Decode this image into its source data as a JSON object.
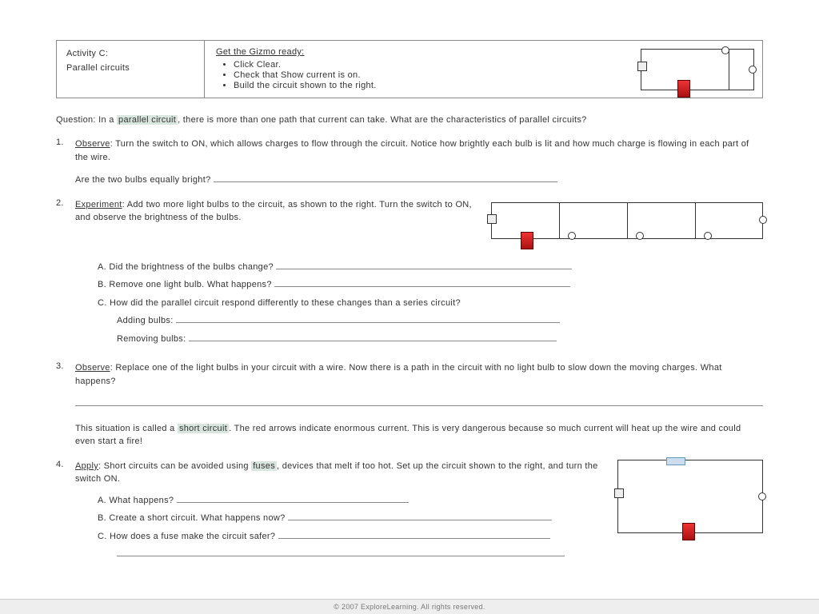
{
  "header": {
    "activity_label": "Activity C:",
    "activity_name": "Parallel circuits",
    "ready_title": "Get the Gizmo ready:",
    "ready_items": [
      "Click Clear.",
      "Check that Show current is on.",
      "Build the circuit shown to the right."
    ]
  },
  "question": {
    "lead": "Question: In a ",
    "hl": "parallel circuit",
    "rest": ", there is more than one path that current can take. What are the characteristics of parallel circuits?"
  },
  "q1": {
    "num": "1.",
    "label": "Observe",
    "text": ": Turn the switch to ON, which allows charges to flow through the circuit. Notice how brightly each bulb is lit and how much charge is flowing in each part of the wire.",
    "prompt": "Are the two bulbs equally bright? "
  },
  "q2": {
    "num": "2.",
    "label": "Experiment",
    "text": ": Add two more light bulbs to the circuit, as shown to the right. Turn the switch to ON, and observe the brightness of the bulbs.",
    "a": "A.   Did the brightness of the bulbs change? ",
    "b": "B.   Remove one light bulb. What happens? ",
    "c": "C.   How did the parallel circuit respond differently to these changes than a series circuit?",
    "c_add": "Adding bulbs: ",
    "c_rem": "Removing bulbs: "
  },
  "q3": {
    "num": "3.",
    "label": "Observe",
    "text": ": Replace one of the light bulbs in your circuit with a wire. Now there is a path in the circuit with no light bulb to slow down the moving charges. What happens?",
    "p2a": "This situation is called a ",
    "p2hl": "short circuit",
    "p2b": ". The red arrows indicate enormous current. This is very dangerous because so much current will heat up the wire and could even start a fire!"
  },
  "q4": {
    "num": "4.",
    "label": "Apply",
    "text1": ": Short circuits can be avoided using ",
    "hl": "fuses",
    "text2": ", devices that melt if too hot. Set up the circuit shown to the right, and turn the switch ON.",
    "a": "A.   What happens? ",
    "b": "B.   Create a short circuit. What happens now? ",
    "c": "C.   How does a fuse make the circuit safer? "
  },
  "footer": "© 2007 ExploreLearning. All rights reserved."
}
